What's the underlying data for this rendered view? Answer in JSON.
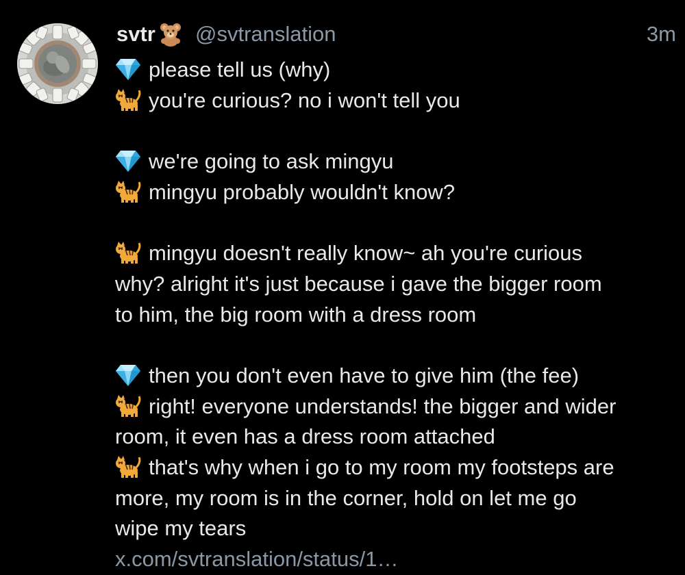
{
  "tweet": {
    "display_name": "svtr",
    "name_emoji": "teddy-bear-icon",
    "handle": "@svtranslation",
    "time": "3m",
    "link": "x.com/svtranslation/status/1…",
    "colors": {
      "background": "#000000",
      "text": "#e7e9ea",
      "secondary": "#8b98a5"
    }
  },
  "lines": [
    {
      "emoji": "gem-icon",
      "text": "please tell us (why)"
    },
    {
      "emoji": "tiger-icon",
      "text": "you're curious? no i won't tell you"
    },
    {
      "emoji": "gem-icon",
      "text": "we're going to ask mingyu"
    },
    {
      "emoji": "tiger-icon",
      "text": "mingyu probably wouldn't know?"
    },
    {
      "emoji": "tiger-icon",
      "text": "mingyu doesn't really know~ ah you're curious"
    },
    {
      "text": "why? alright it's just because i gave the bigger room"
    },
    {
      "text": "to him, the big room with a dress room"
    },
    {
      "emoji": "gem-icon",
      "text": "then you don't even have to give him (the fee)"
    },
    {
      "emoji": "tiger-icon",
      "text": "right! everyone understands! the bigger and wider"
    },
    {
      "text": "room, it even has a dress room attached"
    },
    {
      "emoji": "tiger-icon",
      "text": "that's why when i go to my room my footsteps are"
    },
    {
      "text": "more, my room is in the corner, hold on let me go"
    },
    {
      "text": "wipe my tears"
    }
  ]
}
